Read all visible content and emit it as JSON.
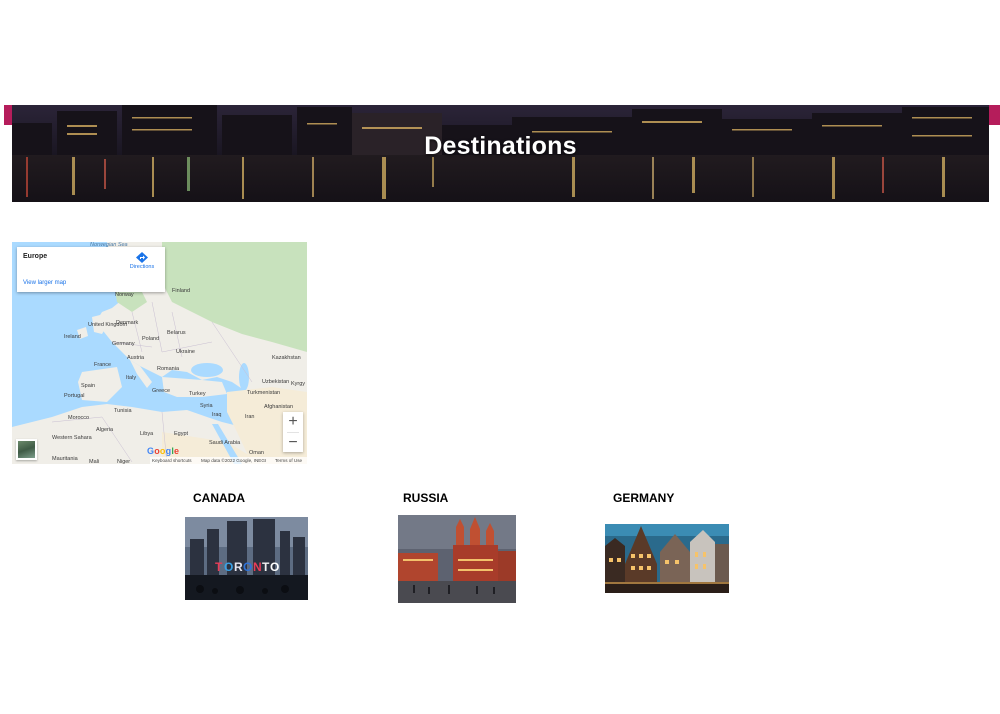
{
  "hero": {
    "title": "Destinations"
  },
  "map": {
    "place_name": "Europe",
    "directions_label": "Directions",
    "view_larger_label": "View larger map",
    "zoom_in_label": "+",
    "zoom_out_label": "−",
    "keyboard_shortcuts_label": "Keyboard shortcuts",
    "attribution": "Map data ©2022 Google, INEGI",
    "terms_label": "Terms of Use",
    "labels": [
      {
        "text": "Norwegian Sea",
        "sea": true
      },
      {
        "text": "Finland",
        "sea": false
      },
      {
        "text": "Norway",
        "sea": false
      },
      {
        "text": "Denmark",
        "sea": false
      },
      {
        "text": "United Kingdom",
        "sea": false
      },
      {
        "text": "Ireland",
        "sea": false
      },
      {
        "text": "Belarus",
        "sea": false
      },
      {
        "text": "Poland",
        "sea": false
      },
      {
        "text": "Germany",
        "sea": false
      },
      {
        "text": "Ukraine",
        "sea": false
      },
      {
        "text": "Kazakhstan",
        "sea": false
      },
      {
        "text": "Austria",
        "sea": false
      },
      {
        "text": "France",
        "sea": false
      },
      {
        "text": "Romania",
        "sea": false
      },
      {
        "text": "Italy",
        "sea": false
      },
      {
        "text": "Spain",
        "sea": false
      },
      {
        "text": "Portugal",
        "sea": false
      },
      {
        "text": "Uzbekistan",
        "sea": false
      },
      {
        "text": "Kyrgy",
        "sea": false
      },
      {
        "text": "Greece",
        "sea": false
      },
      {
        "text": "Turkey",
        "sea": false
      },
      {
        "text": "Turkmenistan",
        "sea": false
      },
      {
        "text": "Afghanistan",
        "sea": false
      },
      {
        "text": "Tunisia",
        "sea": false
      },
      {
        "text": "Syria",
        "sea": false
      },
      {
        "text": "Iraq",
        "sea": false
      },
      {
        "text": "Iran",
        "sea": false
      },
      {
        "text": "Morocco",
        "sea": false
      },
      {
        "text": "Algeria",
        "sea": false
      },
      {
        "text": "Libya",
        "sea": false
      },
      {
        "text": "Egypt",
        "sea": false
      },
      {
        "text": "Saudi Arabia",
        "sea": false
      },
      {
        "text": "Western Sahara",
        "sea": false
      },
      {
        "text": "Mauritania",
        "sea": false
      },
      {
        "text": "Mali",
        "sea": false
      },
      {
        "text": "Niger",
        "sea": false
      },
      {
        "text": "Oman",
        "sea": false
      }
    ]
  },
  "google_logo": "Google",
  "destinations": [
    {
      "name": "CANADA",
      "photo": "toronto-sign-photo"
    },
    {
      "name": "RUSSIA",
      "photo": "moscow-red-square-photo"
    },
    {
      "name": "GERMANY",
      "photo": "german-old-town-photo"
    }
  ],
  "colors": {
    "accent": "#b51d5b",
    "water": "#aadaff",
    "land": "#f0eee8",
    "forest": "#c8e2bd",
    "link": "#1a73e8"
  }
}
